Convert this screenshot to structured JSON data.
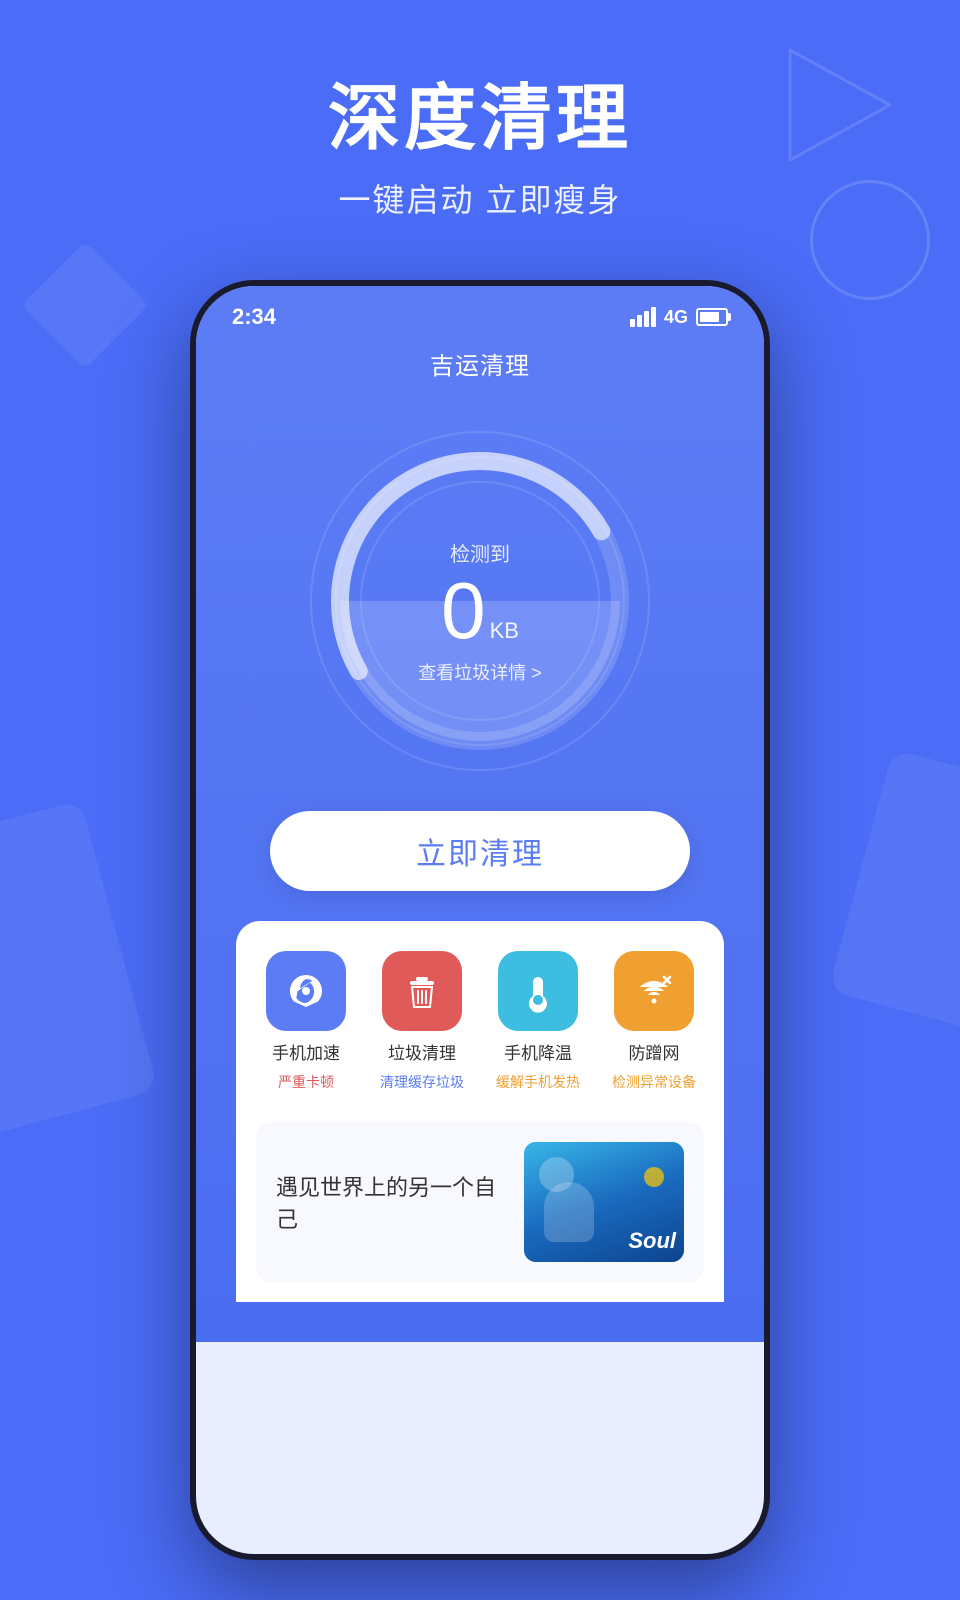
{
  "header": {
    "main_title": "深度清理",
    "sub_title": "一键启动 立即瘦身"
  },
  "phone": {
    "status_bar": {
      "time": "2:34",
      "network": "4G"
    },
    "app_title": "吉运清理",
    "gauge": {
      "detect_label": "检测到",
      "value": "0",
      "unit": "KB",
      "detail_link": "查看垃圾详情 >"
    },
    "clean_button_label": "立即清理",
    "features": [
      {
        "name": "手机加速",
        "status": "严重卡顿",
        "status_color": "red",
        "icon_color": "blue",
        "icon": "🚀"
      },
      {
        "name": "垃圾清理",
        "status": "清理缓存垃圾",
        "status_color": "blue",
        "icon_color": "red",
        "icon": "🧹"
      },
      {
        "name": "手机降温",
        "status": "缓解手机发热",
        "status_color": "orange",
        "icon_color": "cyan",
        "icon": "🌡"
      },
      {
        "name": "防蹭网",
        "status": "检测异常设备",
        "status_color": "orange",
        "icon_color": "orange",
        "icon": "📶"
      }
    ],
    "ad": {
      "text": "遇见世界上的另一个自己",
      "brand": "Soul"
    }
  }
}
